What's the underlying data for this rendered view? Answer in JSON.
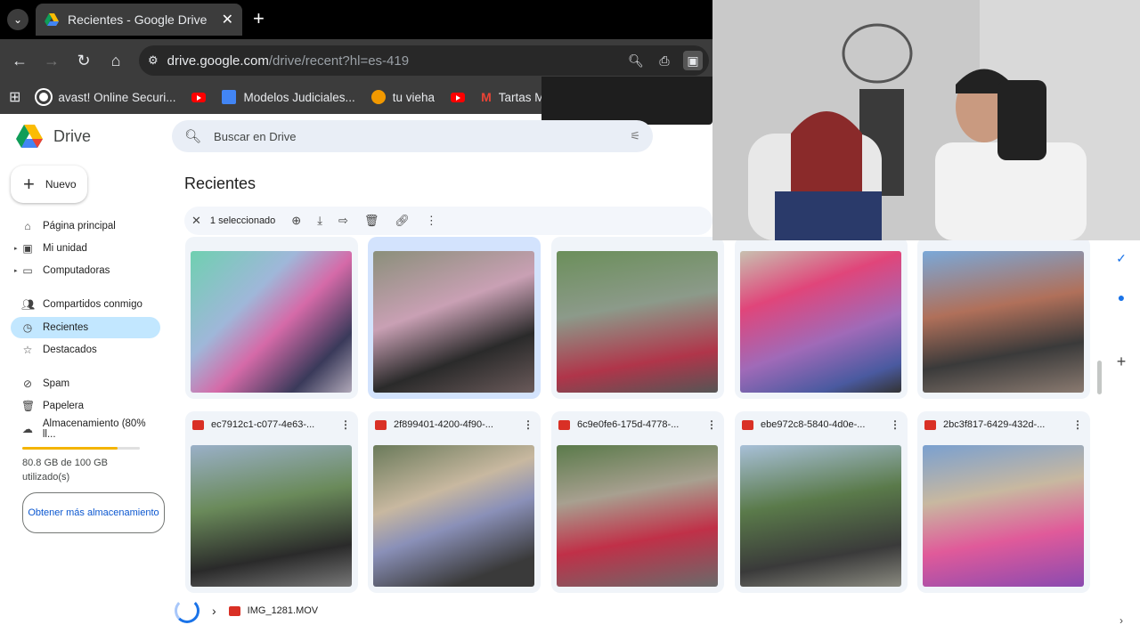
{
  "browser": {
    "tab_title": "Recientes - Google Drive",
    "url_host": "drive.google.com",
    "url_path": "/drive/recent?hl=es-419",
    "bookmarks": [
      "avast! Online Securi...",
      "Modelos Judiciales...",
      "tu vieha",
      "Tartas Modern"
    ]
  },
  "drive": {
    "logo_text": "Drive",
    "search_placeholder": "Buscar en Drive",
    "new_label": "Nuevo",
    "nav": [
      {
        "label": "Página principal",
        "icon": "home-icon"
      },
      {
        "label": "Mi unidad",
        "icon": "drive-icon"
      },
      {
        "label": "Computadoras",
        "icon": "computer-icon"
      },
      {
        "label": "Compartidos conmigo",
        "icon": "people-icon"
      },
      {
        "label": "Recientes",
        "icon": "clock-icon"
      },
      {
        "label": "Destacados",
        "icon": "star-icon"
      },
      {
        "label": "Spam",
        "icon": "spam-icon"
      },
      {
        "label": "Papelera",
        "icon": "trash-icon"
      },
      {
        "label": "Almacenamiento (80% ll...",
        "icon": "cloud-icon"
      }
    ],
    "storage": {
      "used_fraction": 0.808,
      "line1": "80.8 GB de 100 GB",
      "line2": "utilizado(s)",
      "get_more": "Obtener más almacenamiento"
    },
    "page_title": "Recientes",
    "selection": {
      "count_label": "1 seleccionado"
    },
    "files_row2": [
      "ec7912c1-c077-4e63-...",
      "2f899401-4200-4f90-...",
      "6c9e0fe6-175d-4778-...",
      "ebe972c8-5840-4d0e-...",
      "2bc3f817-6429-432d-..."
    ],
    "upload": {
      "file_name": "IMG_1281.MOV"
    }
  },
  "colors": {
    "accent": "#0b57d0",
    "active_nav": "#c2e7ff",
    "storage": "#f4b400"
  }
}
